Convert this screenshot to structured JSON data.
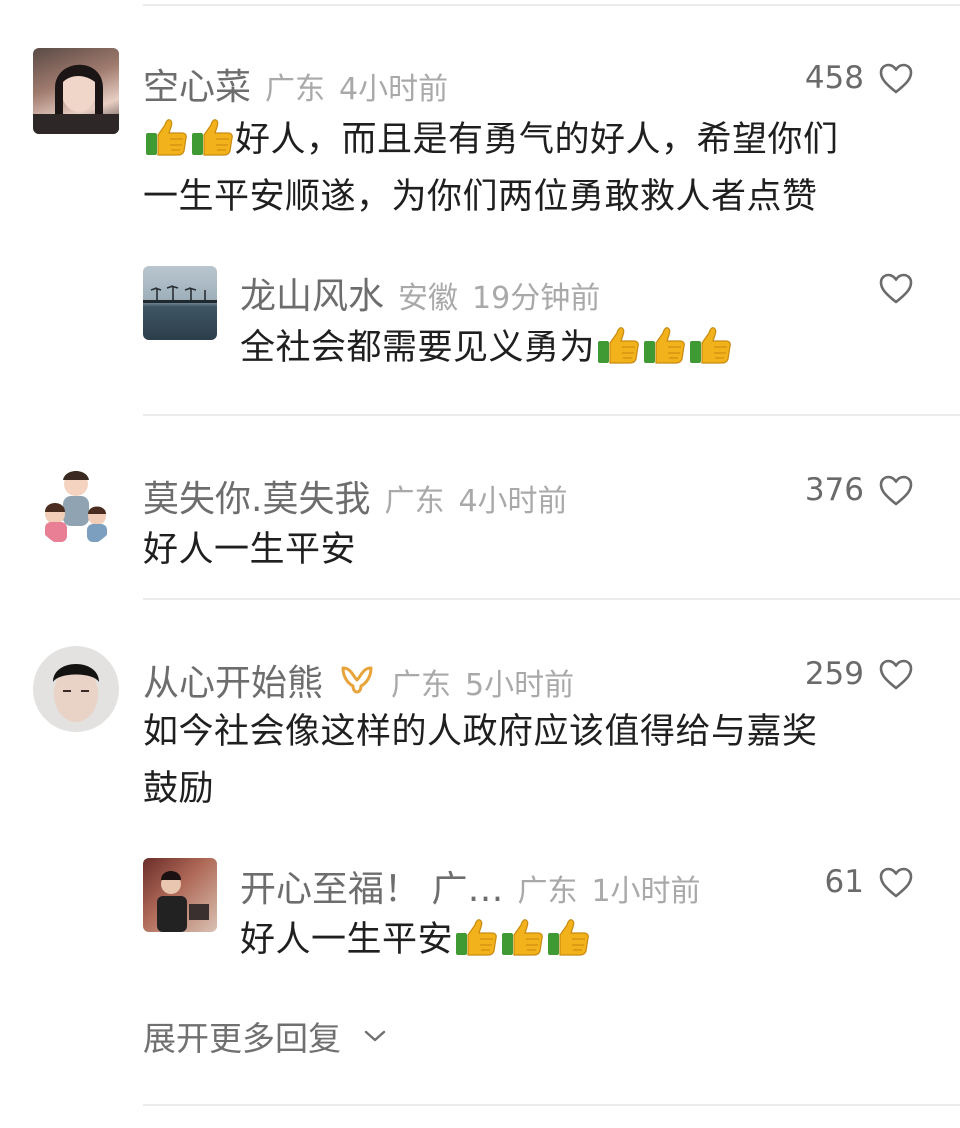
{
  "comments": [
    {
      "user": "空心菜",
      "region": "广东",
      "time": "4小时前",
      "likes": "458",
      "line1": "好人，而且是有勇气的好人，希望你们",
      "line2": "一生平安顺遂，为你们两位勇敢救人者点赞"
    },
    {
      "user": "龙山风水",
      "region": "安徽",
      "time": "19分钟前",
      "likes": "",
      "text": "全社会都需要见义勇为"
    },
    {
      "user": "莫失你.莫失我",
      "region": "广东",
      "time": "4小时前",
      "likes": "376",
      "text": "好人一生平安"
    },
    {
      "user": "从心开始熊",
      "region": "广东",
      "time": "5小时前",
      "likes": "259",
      "line1": "如今社会像这样的人政府应该值得给与嘉奖",
      "line2": "鼓励"
    },
    {
      "user": "开心至福！ 广…",
      "region": "广东",
      "time": "1小时前",
      "likes": "61",
      "text": "好人一生平安"
    }
  ],
  "expand_label": "展开更多回复",
  "icons": {
    "like": "heart-outline-icon",
    "thumbs": "thumbs-up-emoji",
    "badge": "gold-badge-icon",
    "expand": "chevron-down-icon"
  },
  "colors": {
    "like_icon": "#6b6b6b",
    "badge": "#e8a33a"
  }
}
